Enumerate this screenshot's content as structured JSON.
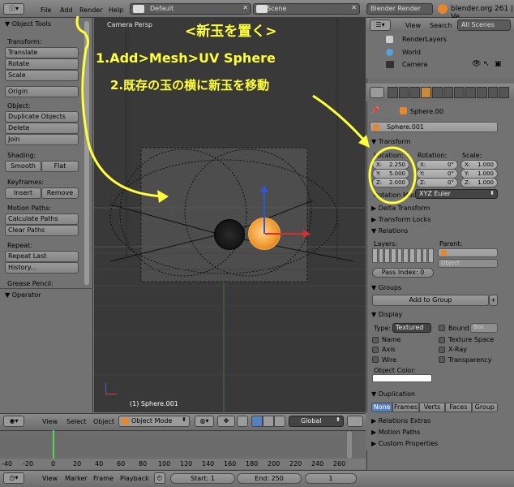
{
  "top_bar": {
    "menus": [
      "File",
      "Add",
      "Render",
      "Help"
    ],
    "layout": "Default",
    "scene": "Scene",
    "engine": "Blender Render",
    "info": "blender.org 261 | Ve"
  },
  "tools": {
    "title": "Object Tools",
    "transform_heading": "Transform:",
    "translate": "Translate",
    "rotate": "Rotate",
    "scale": "Scale",
    "origin": "Origin",
    "object_heading": "Object:",
    "duplicate": "Duplicate Objects",
    "delete": "Delete",
    "join": "Join",
    "shading_heading": "Shading:",
    "smooth": "Smooth",
    "flat": "Flat",
    "keyframes_heading": "Keyframes:",
    "insert": "Insert",
    "remove": "Remove",
    "motion_heading": "Motion Paths:",
    "calc_paths": "Calculate Paths",
    "clear_paths": "Clear Paths",
    "repeat_heading": "Repeat:",
    "repeat_last": "Repeat Last",
    "history": "History...",
    "grease": "Grease Pencil:",
    "operator": "Operator"
  },
  "viewport": {
    "title": "Camera Persp",
    "object_label": "(1) Sphere.001"
  },
  "outliner": {
    "view": "View",
    "search": "Search",
    "all_scenes": "All Scenes",
    "items": [
      "RenderLayers",
      "World",
      "Camera"
    ]
  },
  "properties": {
    "breadcrumb": "Sphere.00",
    "object_name": "Sphere.001",
    "transform": "Transform",
    "location": "Location:",
    "rotation": "Rotation:",
    "scale": "Scale:",
    "loc": [
      [
        "X:",
        "2.250"
      ],
      [
        "Y:",
        "5.000"
      ],
      [
        "Z:",
        "2.000"
      ]
    ],
    "rot": [
      [
        "X:",
        "0°"
      ],
      [
        "Y:",
        "0°"
      ],
      [
        "Z:",
        "0°"
      ]
    ],
    "scl": [
      [
        "X:",
        "1.000"
      ],
      [
        "Y:",
        "1.000"
      ],
      [
        "Z:",
        "1.000"
      ]
    ],
    "rotation_mode_label": "Rotation Mod",
    "rotation_mode": "XYZ Euler",
    "delta": "Delta Transform",
    "locks": "Transform Locks",
    "relations": "Relations",
    "layers": "Layers:",
    "parent": "Parent:",
    "parent_type": "Object",
    "pass_index": "Pass Index: 0",
    "groups": "Groups",
    "add_to_group": "Add to Group",
    "display": "Display",
    "type_label": "Type:",
    "type_value": "Textured",
    "bound": "Bound",
    "box": "Box",
    "name": "Name",
    "texture_space": "Texture Space",
    "axis": "Axis",
    "xray": "X-Ray",
    "wire": "Wire",
    "transparency": "Transparency",
    "object_color": "Object Color:",
    "duplication": "Duplication",
    "dup_tabs": [
      "None",
      "Frames",
      "Verts",
      "Faces",
      "Group"
    ],
    "relations_extras": "Relations Extras",
    "motion_paths": "Motion Paths",
    "custom_props": "Custom Properties"
  },
  "view_header": {
    "view": "View",
    "select": "Select",
    "object": "Object",
    "mode": "Object Mode",
    "orientation": "Global"
  },
  "timeline": {
    "ticks": [
      "-40",
      "-20",
      "0",
      "20",
      "40",
      "60",
      "80",
      "100",
      "120",
      "140",
      "160",
      "180",
      "200",
      "220",
      "240",
      "260"
    ],
    "view": "View",
    "marker": "Marker",
    "frame": "Frame",
    "playback": "Playback",
    "start": "Start: 1",
    "end": "End: 250",
    "current": "1"
  },
  "annotations": {
    "title": "<新玉を置く>",
    "step1": "1.Add>Mesh>UV Sphere",
    "step2": "2.既存の玉の横に新玉を移動"
  },
  "colors": {
    "annotation": "#ffff3a",
    "selected_sphere": "#f0962a",
    "timeline_current": "#5cd35c"
  }
}
